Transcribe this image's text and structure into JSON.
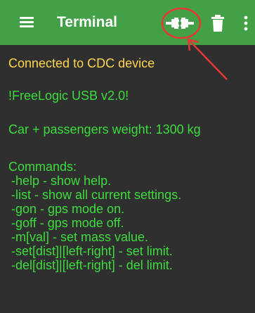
{
  "colors": {
    "appbar": "#43a047",
    "background": "#2f2f2f",
    "status_text": "#ffd54f",
    "device_text": "#3ddc3d",
    "annotation": "#e53935"
  },
  "appbar": {
    "title": "Terminal",
    "menu_icon": "hamburger-menu-icon",
    "connect_icon": "plug-connect-icon",
    "delete_icon": "trash-icon",
    "overflow_icon": "more-vertical-icon"
  },
  "terminal": {
    "status": "Connected to CDC device",
    "banner": "!FreeLogic USB v2.0!",
    "weight": "Car + passengers weight: 1300 kg",
    "commands_header": "Commands:",
    "commands": [
      "-help - show help.",
      "-list - show all current settings.",
      "-gon - gps mode on.",
      "-goff - gps mode off.",
      "-m[val] - set mass value.",
      "-set[dist]|[left-right] - set limit.",
      "-del[dist]|[left-right] - del limit."
    ]
  }
}
